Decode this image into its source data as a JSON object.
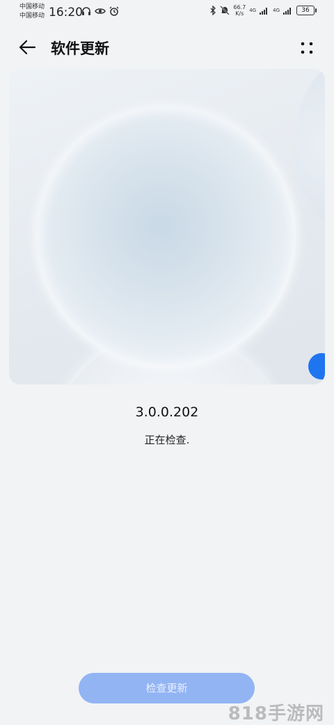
{
  "status_bar": {
    "carrier1": "中国移动",
    "carrier2": "中国移动",
    "time": "16:20",
    "speed_value": "66.7",
    "speed_unit": "K/s",
    "net1": "4G",
    "net2": "4G",
    "battery": "36"
  },
  "header": {
    "title": "软件更新"
  },
  "main": {
    "version": "3.0.0.202",
    "status": "正在检查.",
    "check_button": "检查更新"
  },
  "watermark": "818手游网",
  "colors": {
    "background": "#f1f3f5",
    "accent": "#1f74f0",
    "button_disabled": "#92b4f3"
  }
}
